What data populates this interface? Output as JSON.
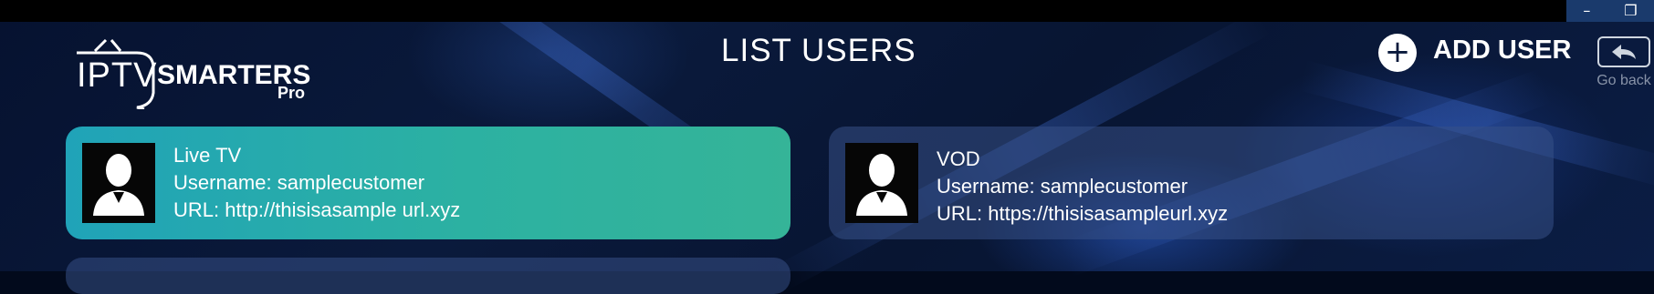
{
  "window": {
    "minimize_icon": "minimize-icon",
    "restore_icon": "restore-icon"
  },
  "logo": {
    "iptv": "IPTV",
    "smarters": "SMARTERS",
    "pro": "Pro"
  },
  "header": {
    "title": "LIST USERS",
    "add_user_label": "ADD USER",
    "add_icon": "plus-circle-icon",
    "go_back_label": "Go back",
    "go_back_icon": "back-arrow-icon"
  },
  "users": [
    {
      "name": "Live TV",
      "username": "Username: samplecustomer",
      "url": "URL: http://thisisasample url.xyz",
      "selected": true
    },
    {
      "name": "VOD",
      "username": "Username: samplecustomer",
      "url": "URL: https://thisisasampleurl.xyz",
      "selected": false
    }
  ],
  "colors": {
    "selected_card": "#2cb1a2",
    "card": "#374f87",
    "background": "#061230"
  }
}
